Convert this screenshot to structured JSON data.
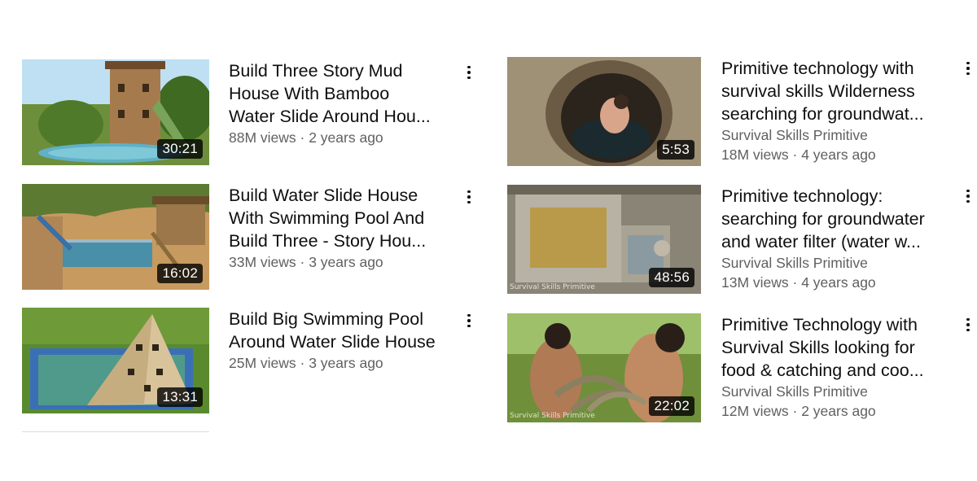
{
  "left_column": [
    {
      "title_lines": [
        "Build Three Story Mud",
        "House With Bamboo",
        "Water Slide Around Hou..."
      ],
      "stats": "88M views · 2 years ago",
      "duration": "30:21"
    },
    {
      "title_lines": [
        "Build Water Slide House",
        "With Swimming Pool And",
        "Build Three -  Story Hou..."
      ],
      "stats": "33M views · 3 years ago",
      "duration": "16:02"
    },
    {
      "title_lines": [
        "Build Big Swimming Pool",
        "Around Water Slide House"
      ],
      "stats": "25M views · 3 years ago",
      "duration": "13:31"
    }
  ],
  "right_column": [
    {
      "title_lines": [
        "Primitive technology with",
        "survival skills Wilderness",
        "searching for groundwat..."
      ],
      "channel": "Survival Skills Primitive",
      "stats": "18M views · 4 years ago",
      "duration": "5:53"
    },
    {
      "title_lines": [
        "Primitive technology:",
        "searching for groundwater",
        "and water filter (water w..."
      ],
      "channel": "Survival Skills Primitive",
      "stats": "13M views · 4 years ago",
      "duration": "48:56",
      "watermark": "Survival Skills Primitive"
    },
    {
      "title_lines": [
        "Primitive Technology with",
        "Survival Skills looking for",
        "food & catching and coo..."
      ],
      "channel": "Survival Skills Primitive",
      "stats": "12M views · 2 years ago",
      "duration": "22:02",
      "watermark": "Survival Skills Primitive"
    }
  ],
  "icons": {
    "more": "more-vert-icon"
  },
  "colors": {
    "text": "#0f0f0f",
    "secondary": "#606060",
    "duration_bg": "#000000"
  }
}
